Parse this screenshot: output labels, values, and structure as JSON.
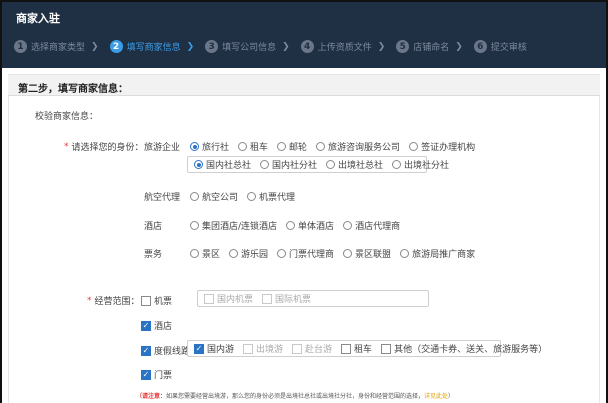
{
  "app_title": "商家入驻",
  "steps": [
    {
      "num": "1",
      "label": "选择商家类型"
    },
    {
      "num": "2",
      "label": "填写商家信息"
    },
    {
      "num": "3",
      "label": "填写公司信息"
    },
    {
      "num": "4",
      "label": "上传资质文件"
    },
    {
      "num": "5",
      "label": "店铺命名"
    },
    {
      "num": "6",
      "label": "提交审核"
    }
  ],
  "section_title": "第二步，填写商家信息：",
  "verify_label": "校验商家信息：",
  "identity": {
    "label": "请选择您的身份：",
    "travel": {
      "label": "旅游企业",
      "options": [
        "旅行社",
        "租车",
        "邮轮",
        "旅游咨询服务公司",
        "签证办理机构"
      ],
      "sub_options": [
        "国内社总社",
        "国内社分社",
        "出境社总社",
        "出境社分社"
      ]
    },
    "aviation": {
      "label": "航空代理",
      "options": [
        "航空公司",
        "机票代理"
      ]
    },
    "hotel": {
      "label": "酒店",
      "options": [
        "集团酒店/连锁酒店",
        "单体酒店",
        "酒店代理商"
      ]
    },
    "ticket": {
      "label": "票务",
      "options": [
        "景区",
        "游乐园",
        "门票代理商",
        "景区联盟",
        "旅游局推广商家"
      ]
    }
  },
  "scope": {
    "label": "经营范围：",
    "flight": {
      "label": "机票",
      "sub": [
        "国内机票",
        "国际机票"
      ]
    },
    "hotel": {
      "label": "酒店"
    },
    "vacation": {
      "label": "度假线路",
      "sub": [
        "国内游",
        "出境游",
        "赴台游",
        "租车",
        "其他（交通卡券、送关、旅游服务等）"
      ]
    },
    "ticket": {
      "label": "门票"
    }
  },
  "note": {
    "tag": "（请注意：",
    "text": "如果您需要经营出境游，那么您的身份必须是出境社总社或出境社分社，身份和经营范围的选择，",
    "link": "详见此处",
    "end": "）"
  }
}
